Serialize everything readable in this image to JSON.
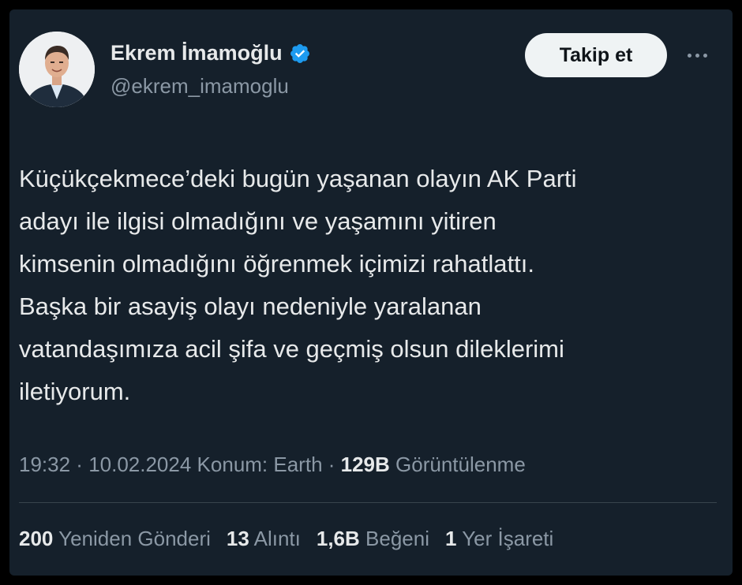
{
  "user": {
    "display_name": "Ekrem İmamoğlu",
    "handle": "@ekrem_imamoglu",
    "verified": true
  },
  "actions": {
    "follow_label": "Takip et",
    "more_icon": "more-horizontal-icon"
  },
  "tweet": {
    "text": "Küçükçekmece’deki bugün yaşanan olayın AK Parti\nadayı ile ilgisi olmadığını ve yaşamını yitiren\nkimsenin olmadığını öğrenmek içimizi rahatlattı.\nBaşka bir asayiş olayı nedeniyle yaralanan\nvatandaşımıza acil şifa ve geçmiş olsun dileklerimi\niletiyorum."
  },
  "meta": {
    "time": "19:32",
    "sep1": " · ",
    "date": "10.02.2024",
    "location": " Konum: Earth",
    "sep2": " · ",
    "views_count": "129B",
    "views_label": " Görüntülenme"
  },
  "stats": {
    "reposts_count": "200",
    "reposts_label": " Yeniden Gönderi",
    "quotes_count": "13",
    "quotes_label": " Alıntı",
    "likes_count": "1,6B",
    "likes_label": " Beğeni",
    "bookmarks_count": "1",
    "bookmarks_label": " Yer İşareti"
  },
  "colors": {
    "background": "#15202b",
    "text": "#e7e9ea",
    "secondary_text": "#8b98a5",
    "verified_badge": "#1d9bf0",
    "follow_button_bg": "#eff3f4"
  }
}
